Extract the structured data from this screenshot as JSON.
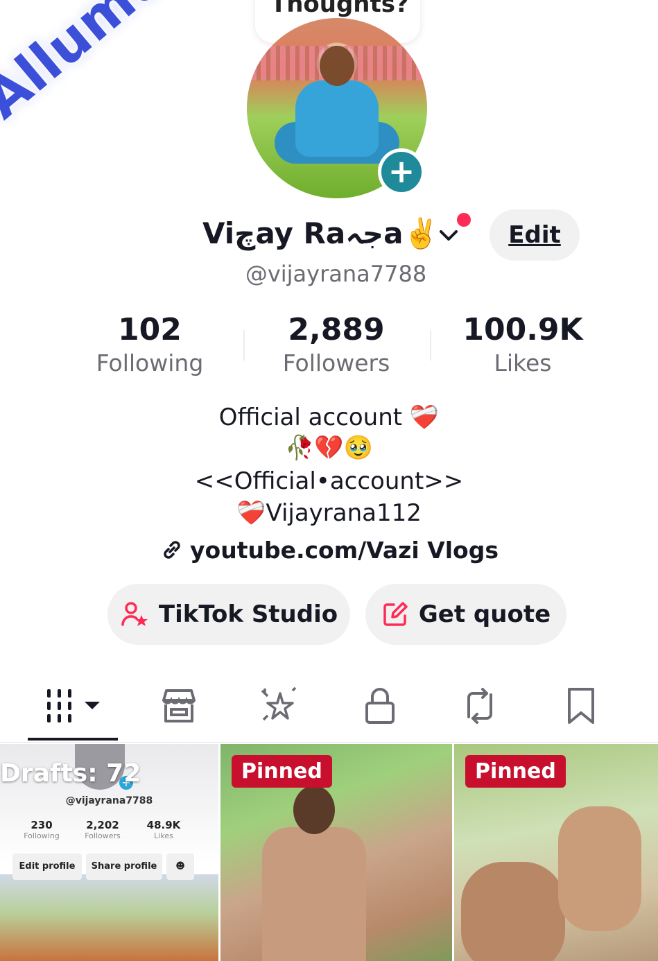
{
  "top": {
    "bubble_text": "Thoughts?"
  },
  "overlay": {
    "watermark": "Allumdullah"
  },
  "profile": {
    "display_name": "Viچay Raجہa✌️",
    "handle": "@vijayrana7788",
    "edit_label": "Edit"
  },
  "stats": [
    {
      "value": "102",
      "label": "Following"
    },
    {
      "value": "2,889",
      "label": "Followers"
    },
    {
      "value": "100.9K",
      "label": "Likes"
    }
  ],
  "bio": {
    "line1": "Official account ❤️‍🩹",
    "line2": "🥀💔🥹",
    "line3": "<<Official•account>>",
    "line4": "❤️‍🩹Vijayrana112",
    "link": "youtube.com/Vazi Vlogs"
  },
  "actions": {
    "studio_label": "TikTok Studio",
    "quote_label": "Get quote"
  },
  "tabs": [
    "videos-grid",
    "shop",
    "sparkle",
    "lock",
    "repost",
    "bookmark"
  ],
  "grid": {
    "drafts": {
      "title": "Drafts: 72",
      "handle": "@vijayrana7788",
      "stats": [
        {
          "value": "230",
          "label": "Following"
        },
        {
          "value": "2,202",
          "label": "Followers"
        },
        {
          "value": "48.9K",
          "label": "Likes"
        }
      ],
      "edit_label": "Edit profile",
      "share_label": "Share profile"
    },
    "pinned_label_1": "Pinned",
    "pinned_label_2": "Pinned"
  },
  "colors": {
    "accent": "#fe2c55",
    "pinned": "#c8102e",
    "plus": "#1e8a9a"
  }
}
